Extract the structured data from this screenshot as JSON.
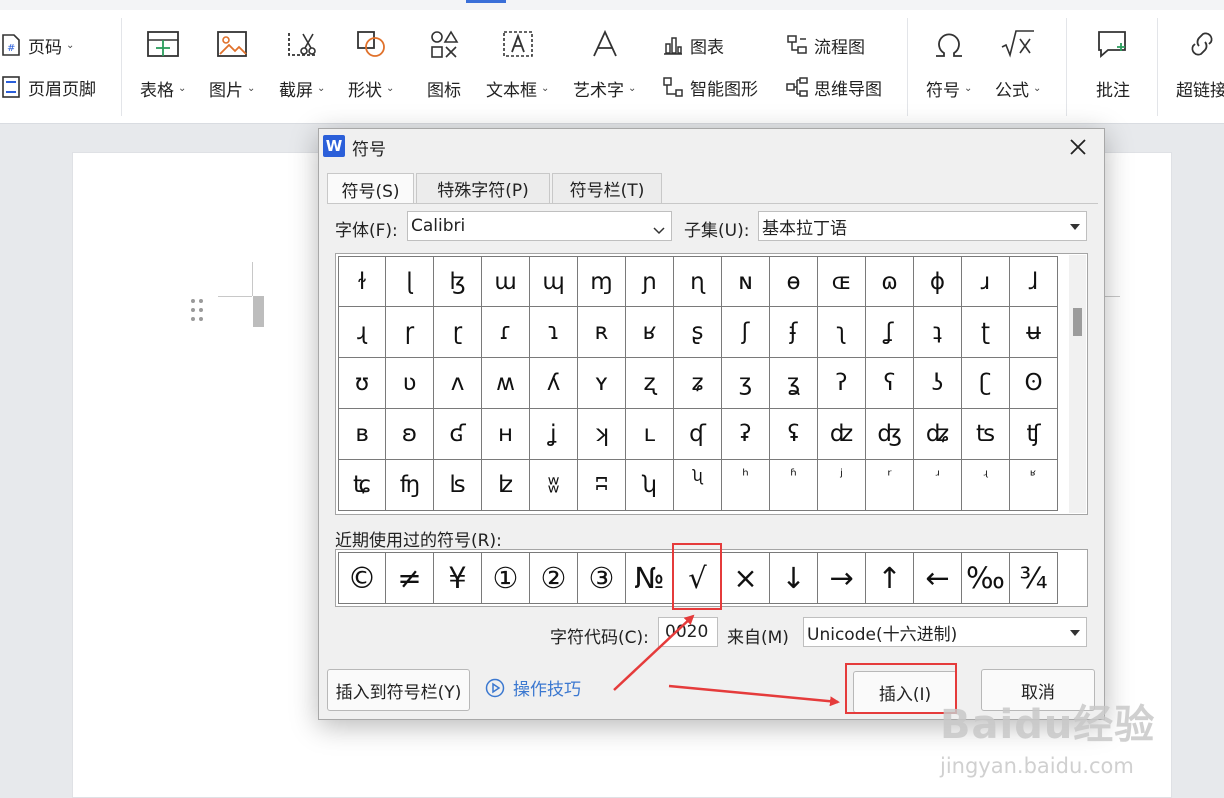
{
  "ribbon": {
    "page_number": "页码",
    "header_footer": "页眉页脚",
    "table": "表格",
    "picture": "图片",
    "screenshot": "截屏",
    "shape": "形状",
    "icon_lib": "图标",
    "textbox": "文本框",
    "wordart": "艺术字",
    "chart": "图表",
    "smartart": "智能图形",
    "flowchart": "流程图",
    "mindmap": "思维导图",
    "symbol": "符号",
    "formula": "公式",
    "comment": "批注",
    "hyperlink": "超链接"
  },
  "dialog": {
    "logo": "W",
    "title": "符号",
    "tabs": [
      "符号(S)",
      "特殊字符(P)",
      "符号栏(T)"
    ],
    "font_label": "字体(F):",
    "font_value": "Calibri",
    "subset_label": "子集(U):",
    "subset_value": "基本拉丁语",
    "symbols": [
      "ɫ",
      "ɭ",
      "ɮ",
      "ɯ",
      "ɰ",
      "ɱ",
      "ɲ",
      "ɳ",
      "ɴ",
      "ɵ",
      "ɶ",
      "ɷ",
      "ɸ",
      "ɹ",
      "ɺ",
      "ɻ",
      "ɼ",
      "ɽ",
      "ɾ",
      "ɿ",
      "ʀ",
      "ʁ",
      "ʂ",
      "ʃ",
      "ʄ",
      "ʅ",
      "ʆ",
      "ʇ",
      "ʈ",
      "ʉ",
      "ʊ",
      "ʋ",
      "ʌ",
      "ʍ",
      "ʎ",
      "ʏ",
      "ʐ",
      "ʑ",
      "ʒ",
      "ʓ",
      "ʔ",
      "ʕ",
      "ʖ",
      "ʗ",
      "ʘ",
      "ʙ",
      "ʚ",
      "ʛ",
      "ʜ",
      "ʝ",
      "ʞ",
      "ʟ",
      "ʠ",
      "ʡ",
      "ʢ",
      "ʣ",
      "ʤ",
      "ʥ",
      "ʦ",
      "ʧ",
      "ʨ",
      "ʩ",
      "ʪ",
      "ʫ",
      "ʬ",
      "ʭ",
      "ʮ",
      "ʯ",
      "ʰ",
      "ʱ",
      "ʲ",
      "ʳ",
      "ʴ",
      "ʵ",
      "ʶ"
    ],
    "recent_label": "近期使用过的符号(R):",
    "recent": [
      "©",
      "≠",
      "¥",
      "①",
      "②",
      "③",
      "№",
      "√",
      "×",
      "↓",
      "→",
      "↑",
      "←",
      "‰",
      "¾"
    ],
    "char_code_label": "字符代码(C):",
    "char_code_value": "0020",
    "from_label": "来自(M)",
    "from_value": "Unicode(十六进制)",
    "insert_to_bar": "插入到符号栏(Y)",
    "tips": "操作技巧",
    "insert": "插入(I)",
    "cancel": "取消"
  },
  "watermark": {
    "brand": "Baidu经验",
    "url": "jingyan.baidu.com"
  },
  "colors": {
    "highlight": "#e53b3b",
    "accent": "#2b5fd9",
    "link": "#3b78d0"
  }
}
